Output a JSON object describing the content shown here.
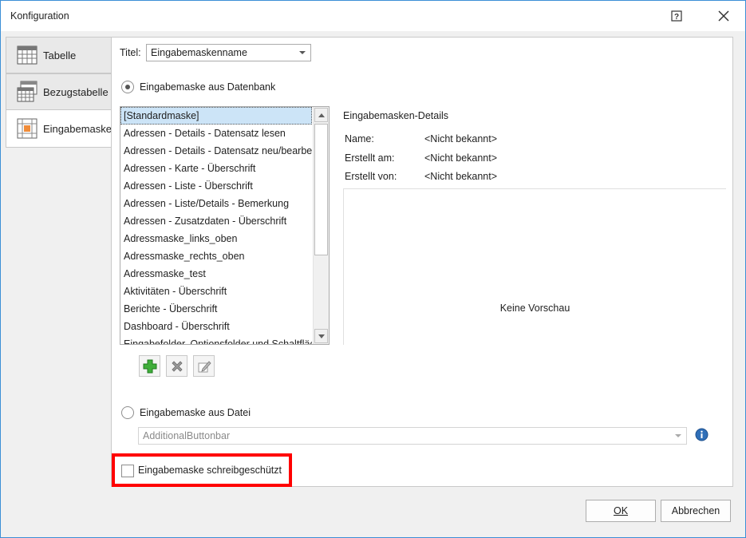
{
  "window": {
    "title": "Konfiguration",
    "help_icon": "help-question-icon",
    "close_icon": "close-icon"
  },
  "tabs": [
    {
      "label": "Tabelle",
      "icon": "table-icon"
    },
    {
      "label": "Bezugstabelle",
      "icon": "related-table-icon"
    },
    {
      "label": "Eingabemaske",
      "icon": "input-mask-icon"
    }
  ],
  "main": {
    "title_label": "Titel:",
    "title_value": "Eingabemaskenname",
    "radio_database_label": "Eingabemaske aus Datenbank",
    "radio_database_checked": true,
    "mask_list": [
      "[Standardmaske]",
      "Adressen - Details - Datensatz lesen",
      "Adressen - Details - Datensatz neu/bearbeiten",
      "Adressen - Karte - Überschrift",
      "Adressen - Liste - Überschrift",
      "Adressen - Liste/Details - Bemerkung",
      "Adressen - Zusatzdaten - Überschrift",
      "Adressmaske_links_oben",
      "Adressmaske_rechts_oben",
      "Adressmaske_test",
      "Aktivitäten - Überschrift",
      "Berichte - Überschrift",
      "Dashboard - Überschrift",
      "Eingabefolder, Optionsfolder und Schaltflächen"
    ],
    "selected_index": 0,
    "details": {
      "heading": "Eingabemasken-Details",
      "name_label": "Name:",
      "name_value": "<Nicht bekannt>",
      "created_on_label": "Erstellt am:",
      "created_on_value": "<Nicht bekannt>",
      "created_by_label": "Erstellt von:",
      "created_by_value": "<Nicht bekannt>",
      "preview_text": "Keine Vorschau"
    },
    "toolbar": {
      "add_icon": "add-plus-icon",
      "delete_icon": "delete-x-icon",
      "edit_icon": "edit-pencil-icon"
    },
    "radio_file_label": "Eingabemaske aus Datei",
    "radio_file_checked": false,
    "file_value": "AdditionalButtonbar",
    "info_icon": "info-icon",
    "readonly_label": "Eingabemaske schreibgeschützt",
    "readonly_checked": false
  },
  "buttons": {
    "ok_label": "OK",
    "cancel_label": "Abbrechen"
  },
  "colors": {
    "highlight": "#ff0000",
    "selection": "#cce4f7",
    "window_border": "#3c8fd6"
  }
}
